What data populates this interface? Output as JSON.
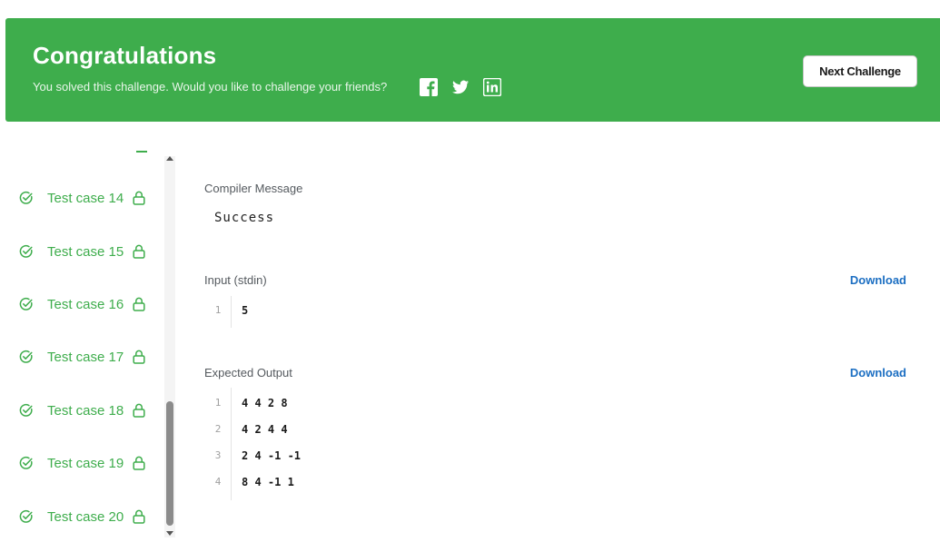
{
  "banner": {
    "title": "Congratulations",
    "subtitle": "You solved this challenge. Would you like to challenge your friends?",
    "social": [
      "facebook-icon",
      "twitter-icon",
      "linkedin-icon"
    ],
    "next_button": "Next Challenge",
    "bg_color": "#3ead4c"
  },
  "sidebar": {
    "test_cases": [
      {
        "label": "Test case 14",
        "status": "passed",
        "locked": true
      },
      {
        "label": "Test case 15",
        "status": "passed",
        "locked": true
      },
      {
        "label": "Test case 16",
        "status": "passed",
        "locked": true
      },
      {
        "label": "Test case 17",
        "status": "passed",
        "locked": true
      },
      {
        "label": "Test case 18",
        "status": "passed",
        "locked": true
      },
      {
        "label": "Test case 19",
        "status": "passed",
        "locked": true
      },
      {
        "label": "Test case 20",
        "status": "passed",
        "locked": true
      }
    ]
  },
  "results": {
    "compiler_label": "Compiler Message",
    "compiler_message": "Success",
    "input_label": "Input (stdin)",
    "input_download": "Download",
    "input_lines": [
      {
        "n": "1",
        "text": "5"
      }
    ],
    "expected_label": "Expected Output",
    "expected_download": "Download",
    "expected_lines": [
      {
        "n": "1",
        "text": "4 4 2 8"
      },
      {
        "n": "2",
        "text": "4 2 4 4"
      },
      {
        "n": "3",
        "text": "2 4 -1 -1"
      },
      {
        "n": "4",
        "text": "8 4 -1 1"
      }
    ]
  }
}
